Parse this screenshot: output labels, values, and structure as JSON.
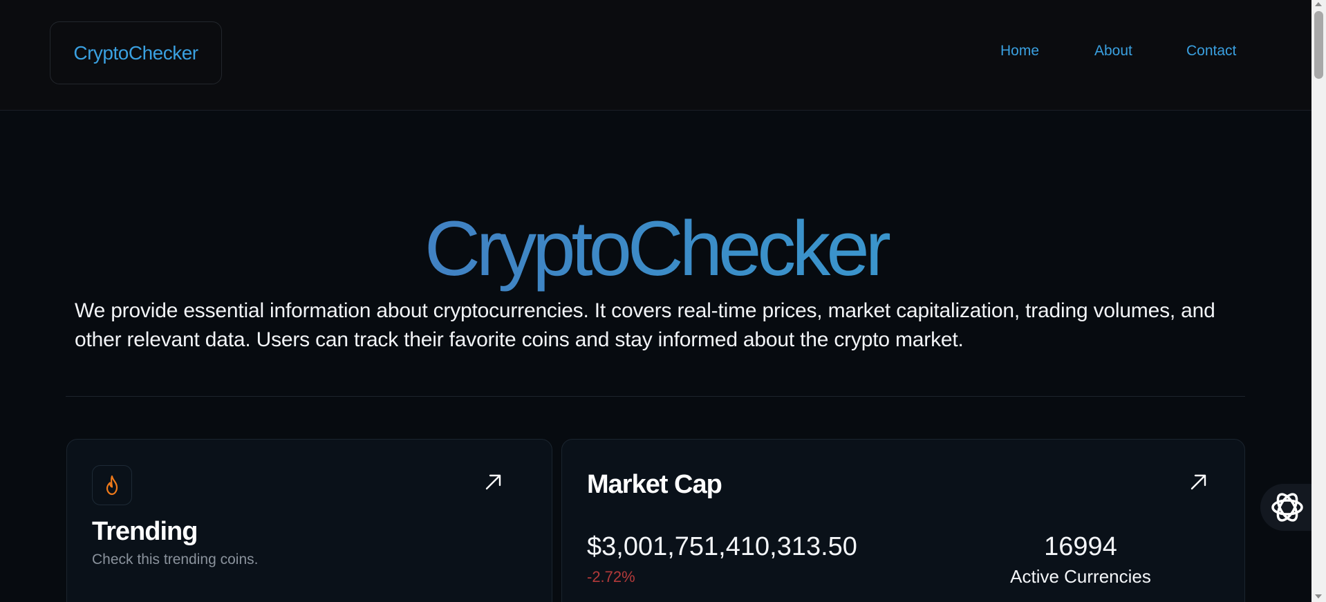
{
  "nav": {
    "logo": "CryptoChecker",
    "links": [
      "Home",
      "About",
      "Contact"
    ]
  },
  "hero": {
    "title": "CryptoChecker",
    "description": "We provide essential information about cryptocurrencies. It covers real-time prices, market capitalization, trading volumes, and other relevant data. Users can track their favorite coins and stay informed about the crypto market."
  },
  "trending": {
    "icon": "flame-icon",
    "title": "Trending",
    "subtitle": "Check this trending coins.",
    "arrow_icon": "arrow-up-right-icon"
  },
  "market": {
    "title": "Market Cap",
    "value": "$3,001,751,410,313.50",
    "change": "-2.72%",
    "active_count": "16994",
    "active_label": "Active Currencies",
    "arrow_icon": "arrow-up-right-icon"
  },
  "floating": {
    "icon": "ai-assistant-icon"
  },
  "colors": {
    "accent": "#3aa0e0",
    "negative": "#b43a3a",
    "flame": "#f07a1a",
    "background": "#070b10"
  }
}
